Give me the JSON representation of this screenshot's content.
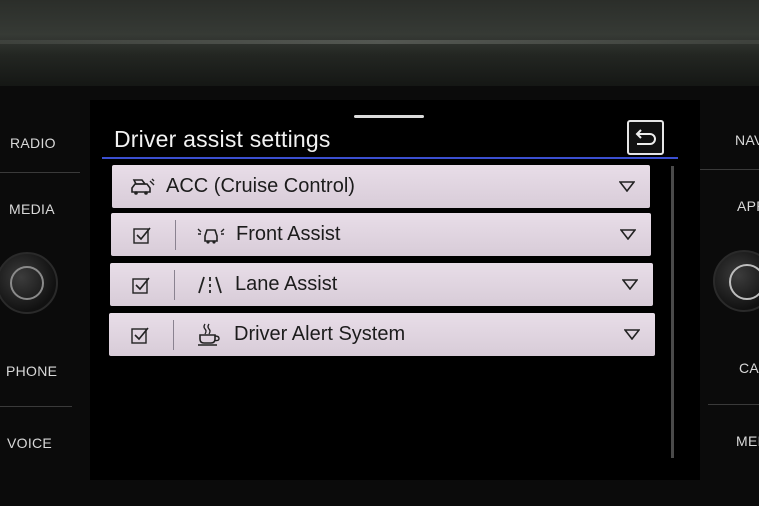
{
  "left_buttons": [
    "RADIO",
    "MEDIA",
    "PHONE",
    "VOICE"
  ],
  "right_buttons": [
    "NAV",
    "APP",
    "CA",
    "MEN"
  ],
  "header": {
    "title": "Driver assist settings"
  },
  "items": [
    {
      "label": "ACC (Cruise Control)",
      "icon": "acc-car-icon",
      "has_checkbox": false
    },
    {
      "label": "Front Assist",
      "icon": "front-assist-car-icon",
      "has_checkbox": true,
      "checked": true
    },
    {
      "label": "Lane Assist",
      "icon": "lane-icon",
      "has_checkbox": true,
      "checked": true
    },
    {
      "label": "Driver Alert System",
      "icon": "coffee-cup-icon",
      "has_checkbox": true,
      "checked": true
    }
  ],
  "colors": {
    "row_bg": "#e0d4e0",
    "accent_line": "#3b4fd0",
    "screen_bg": "#000000"
  }
}
